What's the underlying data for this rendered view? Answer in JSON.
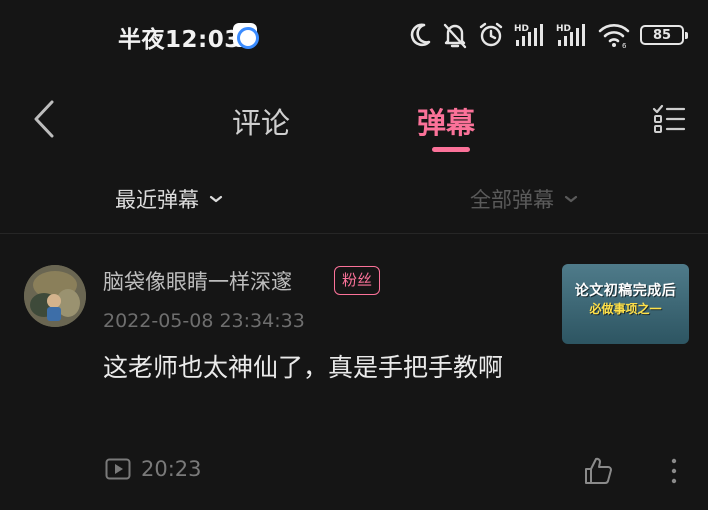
{
  "status_bar": {
    "time": "半夜12:03",
    "battery": "85",
    "icons": [
      "app-notification-icon",
      "moon-icon",
      "mute-bell-icon",
      "alarm-icon",
      "hd-signal-icon",
      "hd-signal-icon",
      "wifi-icon",
      "battery-icon"
    ]
  },
  "header": {
    "tabs": [
      {
        "label": "评论",
        "active": false
      },
      {
        "label": "弹幕",
        "active": true
      }
    ],
    "accent_color": "#fb7299"
  },
  "filters": {
    "recent": "最近弹幕",
    "all": "全部弹幕"
  },
  "danmaku_item": {
    "username": "脑袋像眼睛一样深邃",
    "badge": "粉丝",
    "timestamp": "2022-05-08 23:34:33",
    "content": "这老师也太神仙了，真是手把手教啊",
    "video_time": "20:23",
    "thumbnail": {
      "line1": "论文初稿完成后",
      "line2": "必做事项之一"
    }
  }
}
